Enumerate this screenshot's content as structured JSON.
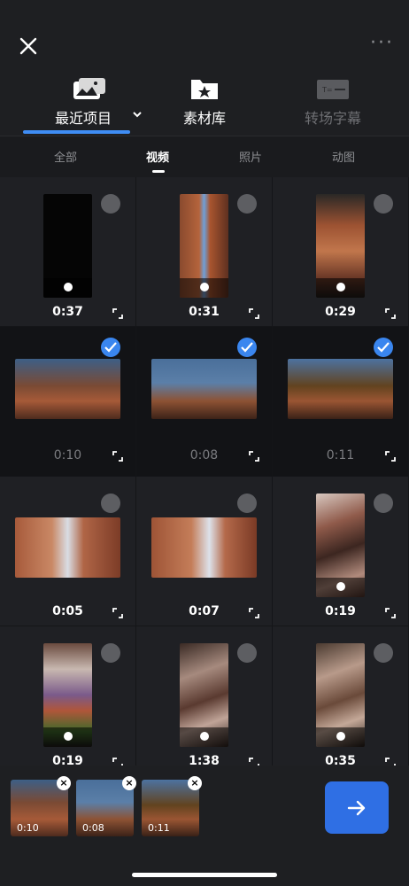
{
  "header": {
    "close_icon": "close-icon",
    "more_icon": "more-horizontal-icon",
    "more_text": "···"
  },
  "source_tabs": [
    {
      "label": "最近项目",
      "icon": "gallery-icon",
      "active": true,
      "chevron": "chevron-down-icon"
    },
    {
      "label": "素材库",
      "icon": "star-folder-icon",
      "active": false
    },
    {
      "label": "转场字幕",
      "icon": "title-card-icon",
      "active": false,
      "dim": true
    }
  ],
  "filter_tabs": [
    {
      "label": "全部",
      "active": false
    },
    {
      "label": "视频",
      "active": true
    },
    {
      "label": "照片",
      "active": false
    },
    {
      "label": "动图",
      "active": false
    }
  ],
  "media": [
    {
      "duration": "0:37",
      "selected": false,
      "orientation": "portrait"
    },
    {
      "duration": "0:31",
      "selected": false,
      "orientation": "portrait"
    },
    {
      "duration": "0:29",
      "selected": false,
      "orientation": "portrait"
    },
    {
      "duration": "0:10",
      "selected": true,
      "orientation": "landscape"
    },
    {
      "duration": "0:08",
      "selected": true,
      "orientation": "landscape"
    },
    {
      "duration": "0:11",
      "selected": true,
      "orientation": "landscape"
    },
    {
      "duration": "0:05",
      "selected": false,
      "orientation": "landscape"
    },
    {
      "duration": "0:07",
      "selected": false,
      "orientation": "landscape"
    },
    {
      "duration": "0:19",
      "selected": false,
      "orientation": "portrait"
    },
    {
      "duration": "0:19",
      "selected": false,
      "orientation": "portrait"
    },
    {
      "duration": "1:38",
      "selected": false,
      "orientation": "portrait"
    },
    {
      "duration": "0:35",
      "selected": false,
      "orientation": "portrait"
    }
  ],
  "tray": {
    "items": [
      {
        "duration": "0:10"
      },
      {
        "duration": "0:08"
      },
      {
        "duration": "0:11"
      }
    ],
    "remove_text": "×",
    "next_icon": "arrow-right-icon"
  },
  "colors": {
    "accent": "#3a86ef",
    "background": "#1e1f22",
    "next_button": "#2f6fe4"
  }
}
